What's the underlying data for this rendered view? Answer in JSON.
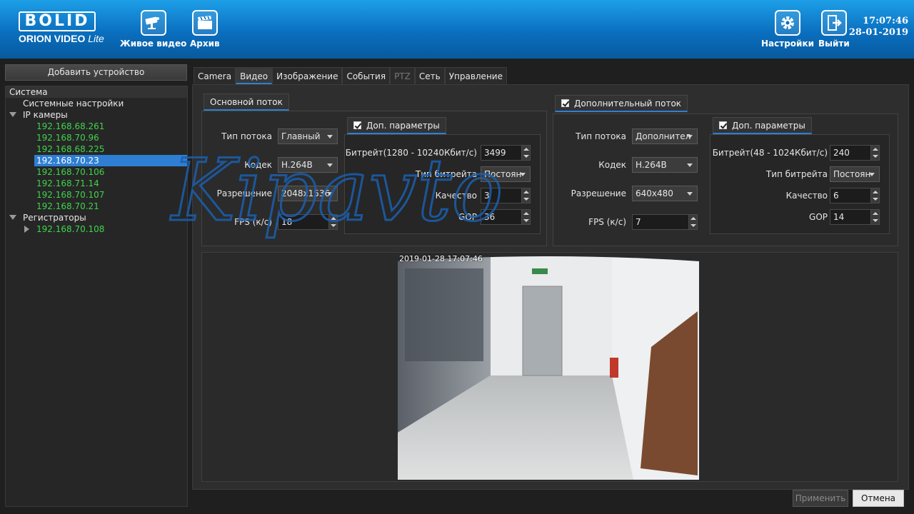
{
  "brand": {
    "logo_top": "BOLID",
    "logo_sub_main": "ORION VIDEO",
    "logo_sub_edition": "Lite"
  },
  "toolbar": {
    "live_label": "Живое видео",
    "archive_label": "Архив",
    "settings_label": "Настройки",
    "exit_label": "Выйти"
  },
  "clock": {
    "time": "17:07:46",
    "date": "28-01-2019"
  },
  "sidebar": {
    "add_device_label": "Добавить устройство",
    "root": "Система",
    "system_settings": "Системные настройки",
    "ip_cameras": "IP камеры",
    "cameras": [
      "192.168.68.261",
      "192.168.70.96",
      "192.168.68.225",
      "192.168.70.23",
      "192.168.70.106",
      "192.168.71.14",
      "192.168.70.107",
      "192.168.70.21"
    ],
    "selected_camera": "192.168.70.23",
    "recorders": "Регистраторы",
    "recorder_items": [
      "192.168.70.108"
    ]
  },
  "tabs": [
    "Camera",
    "Видео",
    "Изображение",
    "События",
    "PTZ",
    "Сеть",
    "Управление"
  ],
  "active_tab": "Видео",
  "main_stream": {
    "title": "Основной поток",
    "stream_type_label": "Тип потока",
    "stream_type": "Главный",
    "codec_label": "Кодек",
    "codec": "H.264B",
    "resolution_label": "Разрешение",
    "resolution": "2048x1536",
    "fps_label": "FPS (к/с)",
    "fps": "18",
    "extra": {
      "title": "Доп. параметры",
      "bitrate_label": "Битрейт(1280 - 10240Кбит/с)",
      "bitrate": "3499",
      "bitrate_type_label": "Тип битрейта",
      "bitrate_type": "Постоян",
      "quality_label": "Качество",
      "quality": "3",
      "gop_label": "GOP",
      "gop": "36"
    }
  },
  "sub_stream": {
    "title": "Дополнительный поток",
    "stream_type_label": "Тип потока",
    "stream_type": "Дополнител",
    "codec_label": "Кодек",
    "codec": "H.264B",
    "resolution_label": "Разрешение",
    "resolution": "640x480",
    "fps_label": "FPS (к/с)",
    "fps": "7",
    "extra": {
      "title": "Доп. параметры",
      "bitrate_label": "Битрейт(48 - 1024Кбит/с)",
      "bitrate": "240",
      "bitrate_type_label": "Тип битрейта",
      "bitrate_type": "Постоян",
      "quality_label": "Качество",
      "quality": "6",
      "gop_label": "GOP",
      "gop": "14"
    }
  },
  "preview": {
    "osd_time": "2019-01-28 17:07:46"
  },
  "footer": {
    "apply_label": "Применить",
    "cancel_label": "Отмена"
  },
  "watermark": {
    "text": "Kipavto"
  },
  "colors": {
    "accent": "#2e7fd4",
    "camera_ip": "#3fd44c",
    "watermark": "#1b5fae"
  }
}
